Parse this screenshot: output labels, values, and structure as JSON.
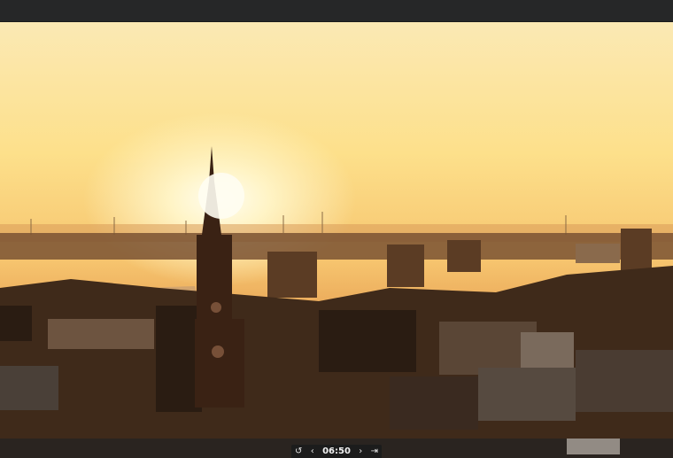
{
  "player": {
    "timestamp": "06:50",
    "controls": {
      "loop_icon": "loop-icon",
      "prev_icon": "chevron-left-icon",
      "next_icon": "chevron-right-icon",
      "end_icon": "skip-end-icon"
    }
  },
  "colors": {
    "topbar": "#262728",
    "sky_top": "#fbe9b4",
    "sun_glow": "#fffdf0",
    "city_shadow": "#2b1e14"
  }
}
